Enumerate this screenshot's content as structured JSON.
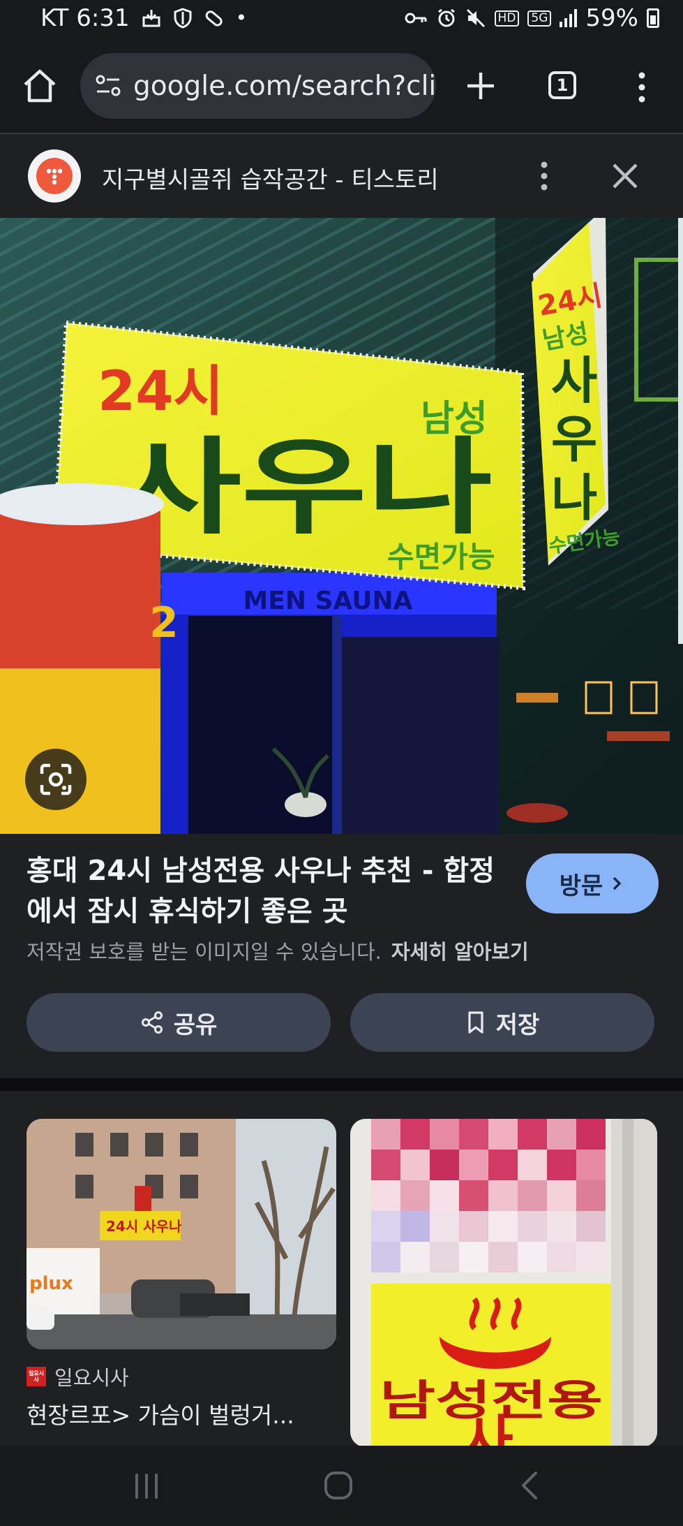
{
  "status_bar": {
    "carrier_time": "KT 6:31",
    "network_badges": [
      "HD",
      "5G"
    ],
    "battery_text": "59%"
  },
  "browser": {
    "url": "google.com/search?clie",
    "tab_count": "1"
  },
  "sheet": {
    "site_title": "지구별시골쥐 습작공간 - 티스토리"
  },
  "hero_image": {
    "sign_main_time": "24시",
    "sign_main_tag": "남성",
    "sign_main_name": "사우나",
    "sign_main_sub": "수면가능",
    "sign_vertical_time": "24시",
    "sign_vertical_tag": "남성",
    "sign_vertical_c1": "사",
    "sign_vertical_c2": "우",
    "sign_vertical_c3": "나",
    "sign_vertical_sub": "수면가능",
    "entrance_sign": "MEN SAUNA",
    "cooler_text": "2"
  },
  "result": {
    "title": "홍대 24시 남성전용 사우나 추천 - 합정에서 잠시 휴식하기 좋은 곳",
    "visit_label": "방문",
    "copyright_notice": "저작권 보호를 받는 이미지일 수 있습니다.",
    "learn_more": "자세히 알아보기",
    "share_label": "공유",
    "save_label": "저장"
  },
  "related": {
    "card1": {
      "sign_text": "24시 사우나",
      "shop_text": "plux",
      "source_logo": "일요시사",
      "source": "일요시사",
      "title": "현장르포> 가슴이 벌렁거..."
    },
    "card2": {
      "sign_text": "남성전용",
      "sign_text2": "사"
    }
  }
}
